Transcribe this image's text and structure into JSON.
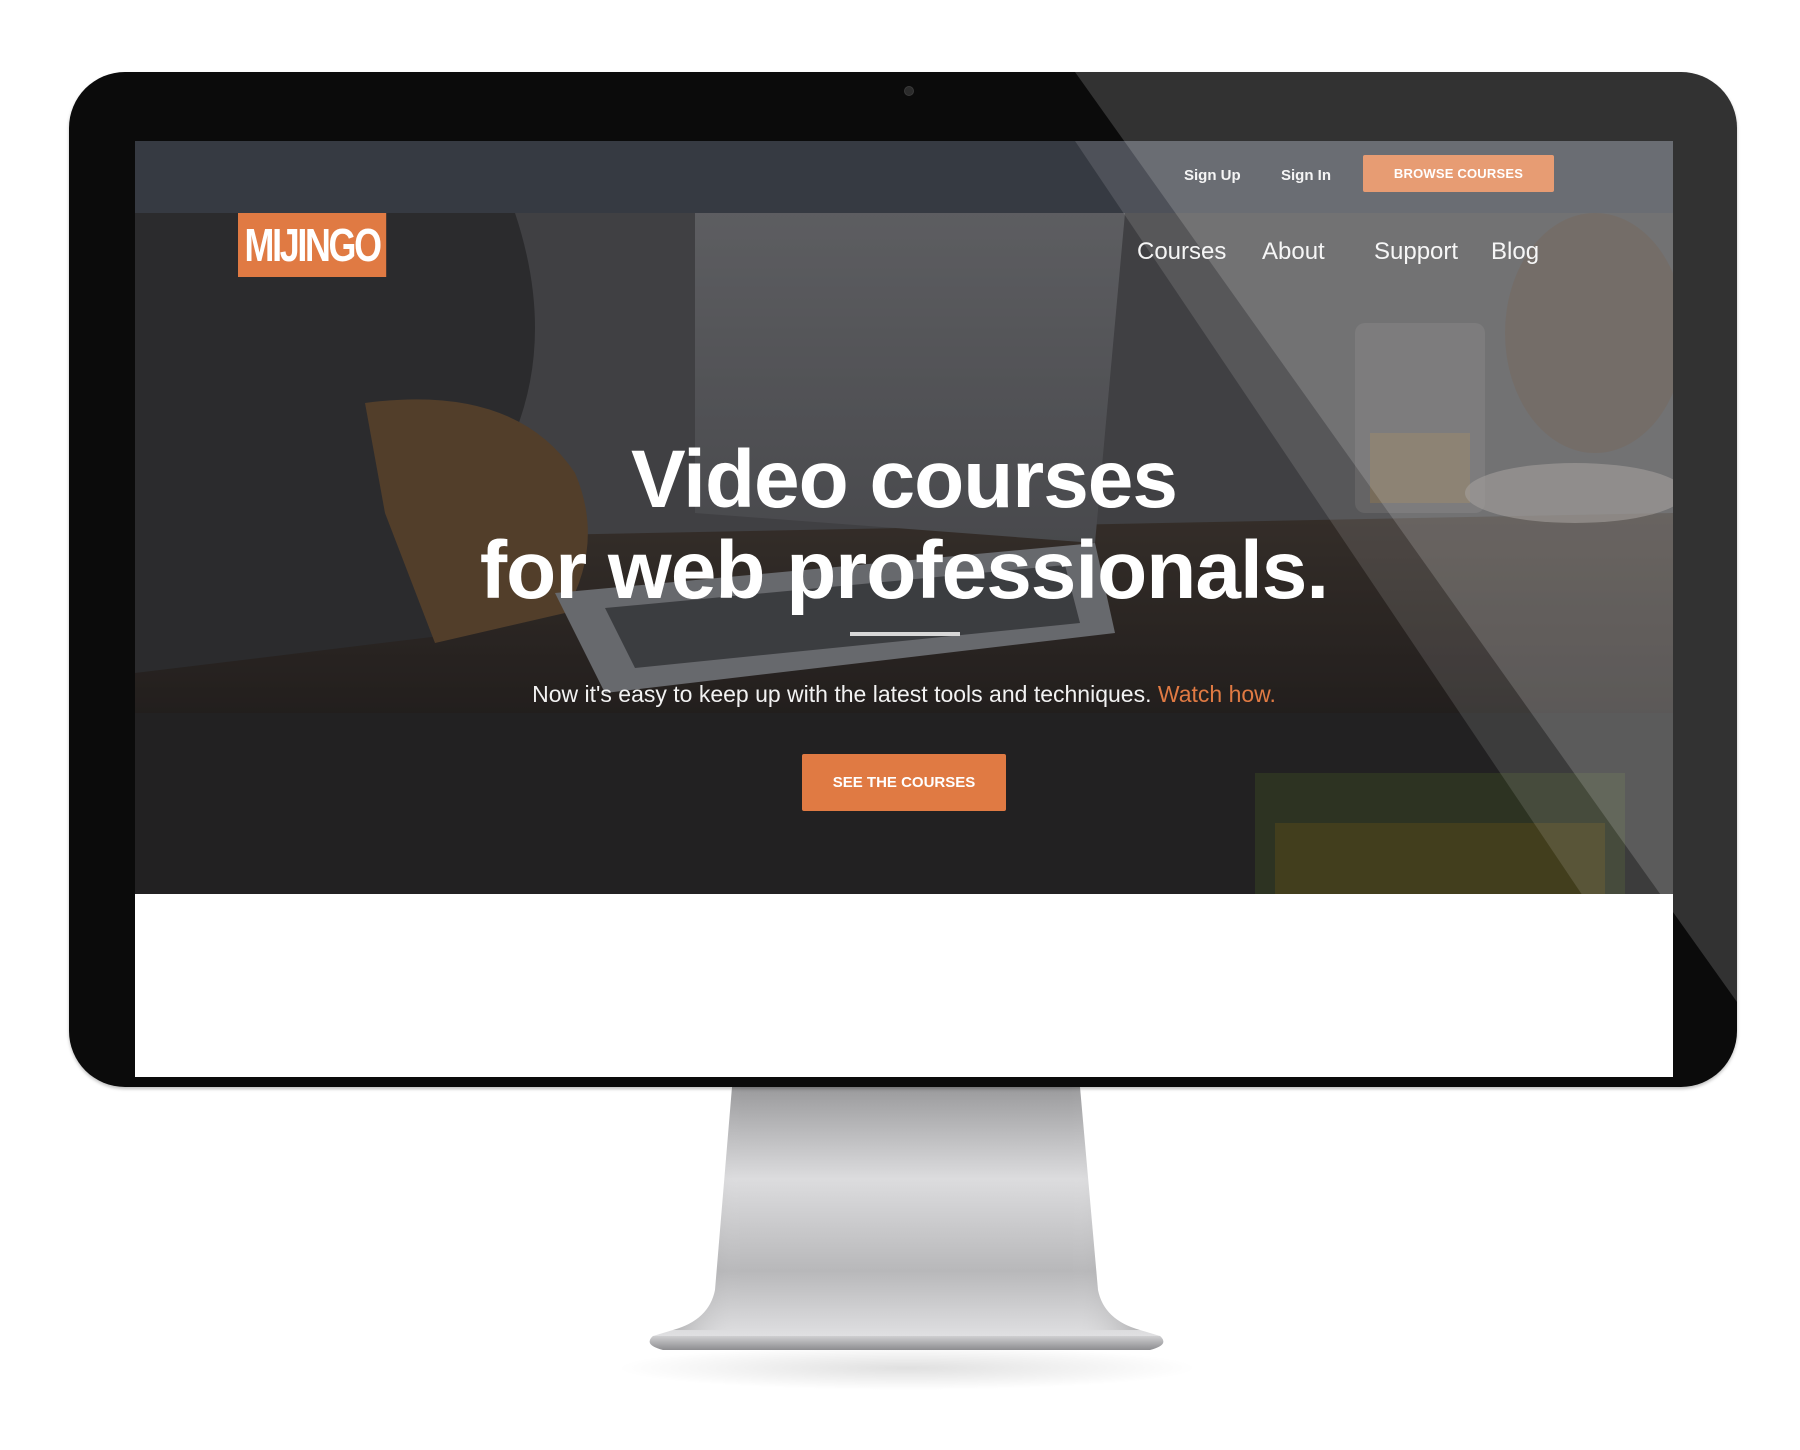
{
  "topbar": {
    "sign_up": "Sign Up",
    "sign_in": "Sign In",
    "browse_courses": "BROWSE COURSES"
  },
  "brand": {
    "logo_text": "MIJINGO",
    "accent_color": "#e07a43",
    "topbar_color": "#363a42"
  },
  "nav": {
    "items": [
      {
        "label": "Courses"
      },
      {
        "label": "About"
      },
      {
        "label": "Support"
      },
      {
        "label": "Blog"
      }
    ]
  },
  "hero": {
    "headline_line1": "Video courses",
    "headline_line2": "for web professionals.",
    "subline_text": "Now it's easy to keep up with the latest tools and techniques.",
    "subline_link": "Watch how.",
    "cta_label": "SEE THE COURSES"
  }
}
